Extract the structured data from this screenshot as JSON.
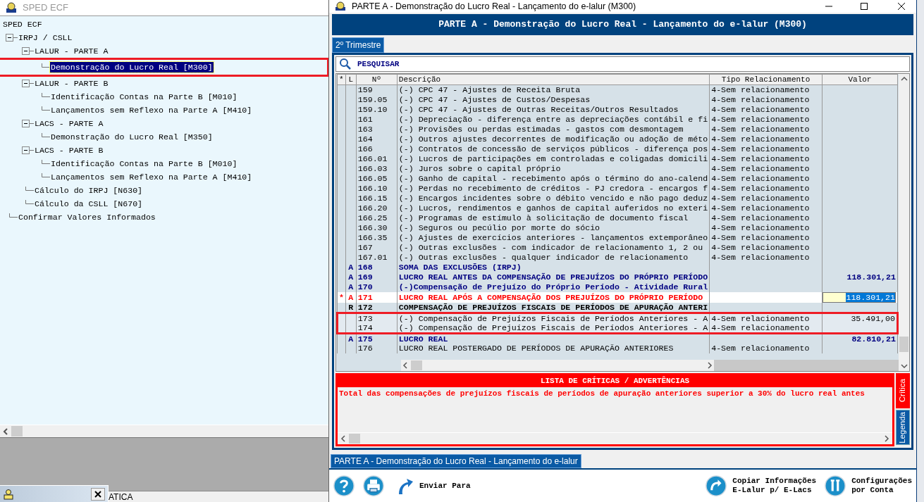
{
  "left_window": {
    "title": "SPED ECF",
    "tree": [
      {
        "label": "SPED ECF",
        "selected": false,
        "expanded": true,
        "children": [
          {
            "label": "IRPJ / CSLL",
            "selected": false,
            "expanded": true,
            "children": [
              {
                "label": "LALUR - PARTE A",
                "selected": false,
                "expanded": true,
                "children": [
                  {
                    "label": "Demonstração do Lucro Real [M300]",
                    "selected": true,
                    "highlighted": true
                  }
                ]
              },
              {
                "label": "LALUR - PARTE B",
                "selected": false,
                "expanded": true,
                "children": [
                  {
                    "label": "Identificação Contas na Parte B [M010]",
                    "selected": false
                  },
                  {
                    "label": "Lançamentos sem Reflexo na Parte A [M410]",
                    "selected": false
                  }
                ]
              },
              {
                "label": "LACS - PARTE A",
                "selected": false,
                "expanded": true,
                "children": [
                  {
                    "label": "Demonstração do Lucro Real [M350]",
                    "selected": false
                  }
                ]
              },
              {
                "label": "LACS - PARTE B",
                "selected": false,
                "expanded": true,
                "children": [
                  {
                    "label": "Identificação Contas na Parte B [M010]",
                    "selected": false
                  },
                  {
                    "label": "Lançamentos sem Reflexo na Parte A [M410]",
                    "selected": false
                  }
                ]
              },
              {
                "label": "Cálculo do IRPJ [N630]",
                "selected": false
              },
              {
                "label": "Cálculo da CSLL [N670]",
                "selected": false
              }
            ]
          },
          {
            "label": "Confirmar Valores Informados",
            "selected": false
          }
        ]
      }
    ]
  },
  "status_text": "ATICA",
  "main_window": {
    "title": "PARTE A - Demonstração do Lucro Real - Lançamento do e-lalur (M300)",
    "header": "PARTE A - Demonstração do Lucro Real - Lançamento do e-lalur (M300)",
    "tabs": [
      {
        "label": "2º Trimestre",
        "selected": true
      }
    ],
    "search": {
      "placeholder": "PESQUISAR"
    },
    "table": {
      "columns": [
        "*",
        "L",
        "Nº",
        "Descrição",
        "Tipo Relacionamento",
        "Valor"
      ],
      "rows": [
        {
          "kind": "account",
          "number": "159",
          "description": "(-) CPC 47 - Ajustes de Receita Bruta",
          "relation": "4-Sem relacionamento"
        },
        {
          "kind": "account",
          "number": "159.05",
          "description": "(-) CPC 47 - Ajustes de Custos/Despesas",
          "relation": "4-Sem relacionamento"
        },
        {
          "kind": "account",
          "number": "159.10",
          "description": "(-) CPC 47 - Ajustes de Outras Receitas/Outros Resultados",
          "relation": "4-Sem relacionamento"
        },
        {
          "kind": "account",
          "number": "161",
          "description": "(-) Depreciação - diferença entre as depreciações contábil e fi",
          "relation": "4-Sem relacionamento"
        },
        {
          "kind": "account",
          "number": "163",
          "description": "(-) Provisões ou perdas estimadas - gastos com desmontagem",
          "relation": "4-Sem relacionamento"
        },
        {
          "kind": "account",
          "number": "164",
          "description": "(-) Outros ajustes decorrentes de modificação ou adoção de méto",
          "relation": "4-Sem relacionamento"
        },
        {
          "kind": "account",
          "number": "166",
          "description": "(-) Contratos de concessão de serviços públicos - diferença pos",
          "relation": "4-Sem relacionamento"
        },
        {
          "kind": "account",
          "number": "166.01",
          "description": "(-) Lucros de participações em controladas e coligadas domicili",
          "relation": "4-Sem relacionamento"
        },
        {
          "kind": "account",
          "number": "166.03",
          "description": "(-) Juros sobre o capital próprio",
          "relation": "4-Sem relacionamento"
        },
        {
          "kind": "account",
          "number": "166.05",
          "description": "(-) Ganho de capital - recebimento após o término do ano-calend",
          "relation": "4-Sem relacionamento"
        },
        {
          "kind": "account",
          "number": "166.10",
          "description": "(-) Perdas no recebimento de créditos - PJ credora - encargos f",
          "relation": "4-Sem relacionamento"
        },
        {
          "kind": "account",
          "number": "166.15",
          "description": "(-) Encargos incidentes sobre o débito vencido e não pago deduz",
          "relation": "4-Sem relacionamento"
        },
        {
          "kind": "account",
          "number": "166.20",
          "description": "(-) Lucros, rendimentos e ganhos de capital auferidos no exteri",
          "relation": "4-Sem relacionamento"
        },
        {
          "kind": "account",
          "number": "166.25",
          "description": "(-) Programas de estímulo à solicitação de documento fiscal",
          "relation": "4-Sem relacionamento"
        },
        {
          "kind": "account",
          "number": "166.30",
          "description": "(-) Seguros ou pecúlio por morte do sócio",
          "relation": "4-Sem relacionamento"
        },
        {
          "kind": "account",
          "number": "166.35",
          "description": "(-) Ajustes de exercícios anteriores - lançamentos extemporâneo",
          "relation": "4-Sem relacionamento"
        },
        {
          "kind": "account",
          "number": "167",
          "description": "(-) Outras exclusões - com indicador de relacionamento 1, 2 ou",
          "relation": "4-Sem relacionamento"
        },
        {
          "kind": "account",
          "number": "167.01",
          "description": "(-) Outras exclusões - qualquer indicador de relacionamento",
          "relation": "4-Sem relacionamento"
        },
        {
          "kind": "total",
          "type": "A",
          "number": "168",
          "description": "SOMA DAS EXCLUSÕES (IRPJ)"
        },
        {
          "kind": "total",
          "type": "A",
          "number": "169",
          "description": "LUCRO REAL ANTES DA COMPENSAÇÃO DE PREJUÍZOS DO PRÓPRIO PERÍODO",
          "value": "118.301,21"
        },
        {
          "kind": "total",
          "type": "A",
          "number": "170",
          "description": "(-)Compensação de Prejuízo do Próprio Período - Atividade Rural"
        },
        {
          "kind": "editing",
          "flag": "*",
          "type": "A",
          "number": "171",
          "description": "LUCRO REAL APÓS A COMPENSAÇÃO DOS PREJUÍZOS DO PRÓPRIO PERÍODO",
          "value": "118.301,21"
        },
        {
          "kind": "group",
          "type": "R",
          "number": "172",
          "description": "COMPENSAÇÃO DE PREJUÍZOS FISCAIS DE PERÍODOS DE APURAÇÃO ANTERI"
        },
        {
          "kind": "account",
          "number": "173",
          "description": "(-) Compensação de Prejuízos Fiscais de Períodos Anteriores - A",
          "relation": "4-Sem relacionamento",
          "value": "35.491,00",
          "highlighted": true
        },
        {
          "kind": "account",
          "number": "174",
          "description": "(-) Compensação de Prejuízos Fiscais de Períodos Anteriores - A",
          "relation": "4-Sem relacionamento",
          "highlighted": true
        },
        {
          "kind": "total",
          "type": "A",
          "number": "175",
          "description": "LUCRO REAL",
          "value": "82.810,21"
        },
        {
          "kind": "account",
          "number": "176",
          "description": "LUCRO REAL POSTERGADO DE PERÍODOS DE APURAÇÃO ANTERIORES",
          "relation": "4-Sem relacionamento"
        }
      ]
    },
    "critiques": {
      "title": "LISTA DE CRÍTICAS / ADVERTÊNCIAS",
      "messages": [
        "Total das compensações de prejuízos fiscais de períodos de apuração anteriores superior a 30% do lucro real antes"
      ],
      "side_tabs": [
        {
          "label": "Crítica",
          "selected": true
        },
        {
          "label": "Legenda",
          "selected": false
        }
      ]
    },
    "bottom_tabs": [
      {
        "label": "PARTE A - Demonstração do Lucro Real - Lançamento do e-lalur",
        "selected": true
      }
    ],
    "toolbar": [
      {
        "kind": "help"
      },
      {
        "kind": "print"
      },
      {
        "kind": "send",
        "label": "Enviar Para"
      },
      {
        "kind": "copy",
        "label": "Copiar Informações\nE-Lalur p/ E-Lacs"
      },
      {
        "kind": "settings",
        "label": "Configurações\npor Conta"
      }
    ]
  }
}
